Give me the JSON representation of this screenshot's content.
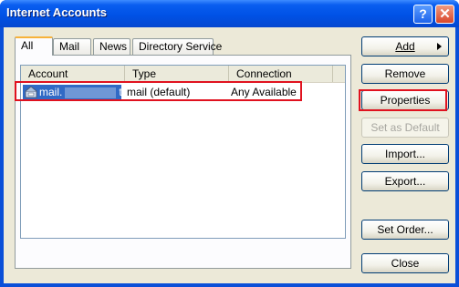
{
  "window": {
    "title": "Internet Accounts"
  },
  "tabs": [
    {
      "label": "All",
      "active": true
    },
    {
      "label": "Mail",
      "active": false
    },
    {
      "label": "News",
      "active": false
    },
    {
      "label": "Directory Service",
      "active": false
    }
  ],
  "list": {
    "columns": [
      "Account",
      "Type",
      "Connection"
    ],
    "rows": [
      {
        "account": "mail.",
        "account_suffix": "t",
        "type": "mail (default)",
        "connection": "Any Available"
      }
    ]
  },
  "buttons": {
    "add": "Add",
    "remove": "Remove",
    "properties": "Properties",
    "set_default": "Set as Default",
    "import": "Import...",
    "export": "Export...",
    "set_order": "Set Order...",
    "close": "Close"
  },
  "icons": {
    "help": "?",
    "close": "✕"
  },
  "colors": {
    "highlight": "#e0121f",
    "selection": "#316ac5",
    "titlebar": "#0052e6"
  }
}
